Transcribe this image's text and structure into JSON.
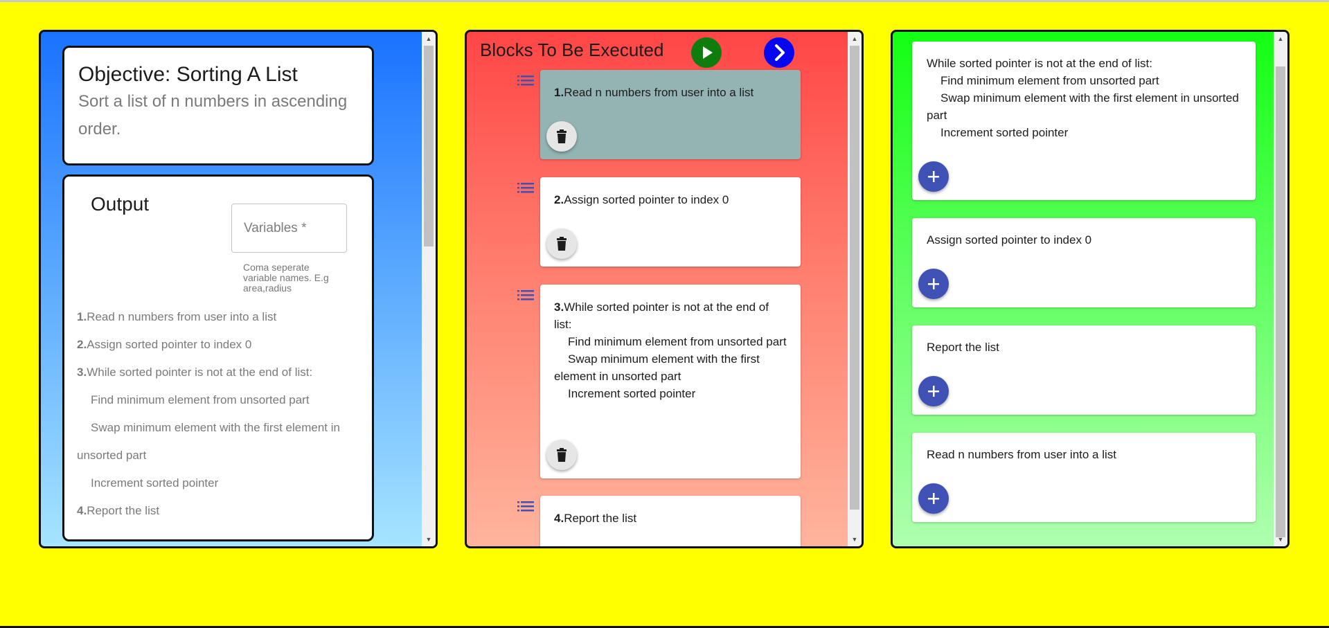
{
  "objective": {
    "title": "Objective: Sorting A List",
    "description": "Sort a list of n numbers in ascending order."
  },
  "output": {
    "title": "Output",
    "variables_placeholder": "Variables *",
    "variables_help": "Coma seperate variable names. E.g area,radius",
    "lines": [
      {
        "num": "1.",
        "text": "Read n numbers from user into a list"
      },
      {
        "num": "2.",
        "text": "Assign sorted pointer to index 0"
      },
      {
        "num": "3.",
        "text": "While sorted pointer is not at the end of list:"
      },
      {
        "num": "",
        "text": "Find minimum element from unsorted part"
      },
      {
        "num": "",
        "text": "Swap minimum element with the first element in unsorted part"
      },
      {
        "num": "",
        "text": "Increment sorted pointer"
      },
      {
        "num": "4.",
        "text": "Report the list"
      }
    ]
  },
  "execute": {
    "title": "Blocks To Be Executed",
    "icons": {
      "play": "play-icon",
      "next": "chevron-right-icon",
      "drag": "list-icon",
      "delete": "trash-icon"
    },
    "blocks": [
      {
        "num": "1.",
        "lines": [
          "Read n numbers from user into a list"
        ]
      },
      {
        "num": "2.",
        "lines": [
          "Assign sorted pointer to index 0"
        ]
      },
      {
        "num": "3.",
        "lines": [
          "While sorted pointer is not at the end of list:",
          "Find minimum element from unsorted part",
          "Swap minimum element with the first element in unsorted part",
          "Increment sorted pointer"
        ]
      },
      {
        "num": "4.",
        "lines": [
          "Report the list"
        ]
      }
    ]
  },
  "available": {
    "icons": {
      "add": "plus-icon"
    },
    "blocks": [
      {
        "lines": [
          "While sorted pointer is not at the end of list:",
          "Find minimum element from unsorted part",
          "Swap minimum element with the first element in unsorted part",
          "Increment sorted pointer"
        ]
      },
      {
        "lines": [
          "Assign sorted pointer to index 0"
        ]
      },
      {
        "lines": [
          "Report the list"
        ]
      },
      {
        "lines": [
          "Read n numbers from user into a list"
        ]
      }
    ]
  },
  "colors": {
    "page_background": "#ffff00",
    "objective_panel": "#1a72ff",
    "execute_panel": "#ff4646",
    "blocks_panel": "#13ff13",
    "active_block": "#94b4b4",
    "accent": "#3f51b5",
    "play": "#0e7d0e",
    "next": "#0707ef"
  }
}
